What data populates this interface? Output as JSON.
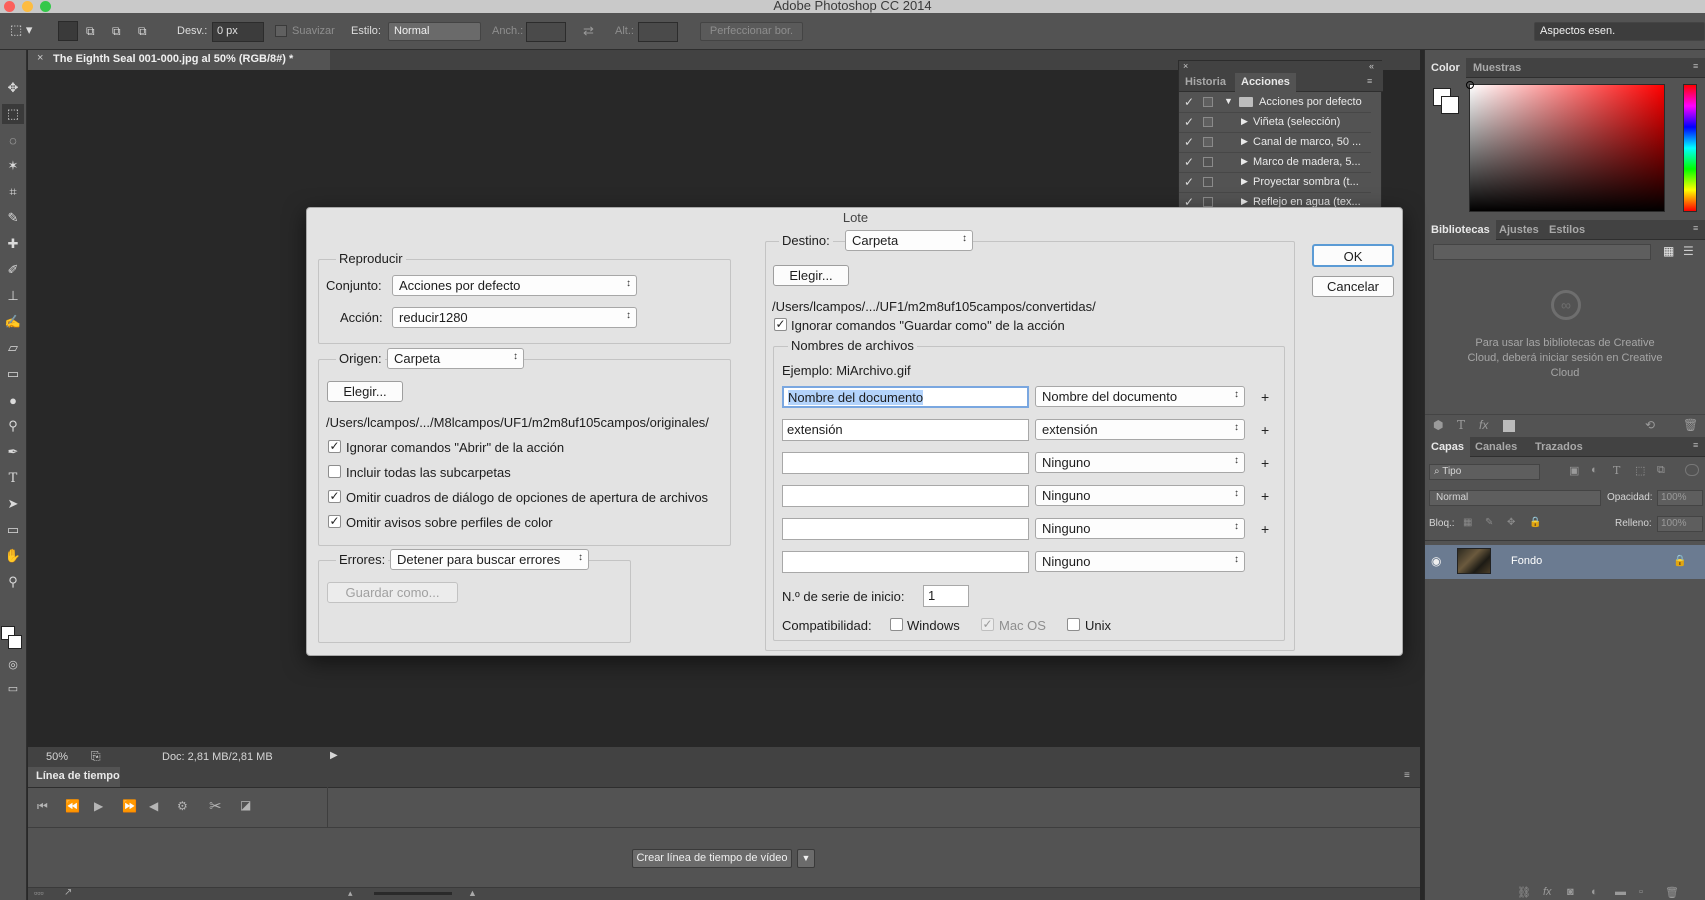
{
  "app": {
    "title": "Adobe Photoshop CC 2014"
  },
  "options_bar": {
    "desv_label": "Desv.:",
    "desv_value": "0 px",
    "suavizar_label": "Suavizar",
    "estilo_label": "Estilo:",
    "estilo_value": "Normal",
    "anch_label": "Anch.:",
    "alt_label": "Alt.:",
    "refine_label": "Perfeccionar bor.",
    "workspace": "Aspectos esen."
  },
  "document": {
    "tab_title": "The Eighth Seal 001-000.jpg al 50% (RGB/8#) *",
    "zoom": "50%",
    "doc_info": "Doc: 2,81 MB/2,81 MB"
  },
  "timeline": {
    "title": "Línea de tiempo",
    "create_button": "Crear línea de tiempo de vídeo"
  },
  "actions_panel": {
    "tabs": [
      "Historia",
      "Acciones"
    ],
    "items": [
      {
        "label": "Acciones por defecto"
      },
      {
        "label": "Viñeta (selección)"
      },
      {
        "label": "Canal de marco, 50 ..."
      },
      {
        "label": "Marco de madera, 5..."
      },
      {
        "label": "Proyectar sombra (t..."
      },
      {
        "label": "Reflejo en agua (tex..."
      }
    ]
  },
  "color_panel": {
    "tabs": [
      "Color",
      "Muestras"
    ]
  },
  "libraries_panel": {
    "tabs": [
      "Bibliotecas",
      "Ajustes",
      "Estilos"
    ],
    "message": "Para usar las bibliotecas de Creative Cloud, deberá iniciar sesión en Creative Cloud"
  },
  "layers_panel": {
    "tabs": [
      "Capas",
      "Canales",
      "Trazados"
    ],
    "filter": "Tipo",
    "blend_mode": "Normal",
    "opacity_label": "Opacidad:",
    "opacity_value": "100%",
    "lock_label": "Bloq.:",
    "fill_label": "Relleno:",
    "fill_value": "100%",
    "layers": [
      {
        "name": "Fondo"
      }
    ]
  },
  "dialog": {
    "title": "Lote",
    "ok": "OK",
    "cancel": "Cancelar",
    "reproducir": {
      "legend": "Reproducir",
      "conjunto_label": "Conjunto:",
      "conjunto_value": "Acciones por defecto",
      "accion_label": "Acción:",
      "accion_value": "reducir1280"
    },
    "origen": {
      "label": "Origen:",
      "value": "Carpeta",
      "choose": "Elegir...",
      "path": "/Users/lcampos/.../M8lcampos/UF1/m2m8uf105campos/originales/",
      "options": [
        {
          "label": "Ignorar comandos \"Abrir\" de la acción",
          "checked": true
        },
        {
          "label": "Incluir todas las subcarpetas",
          "checked": false
        },
        {
          "label": "Omitir cuadros de diálogo de opciones de apertura de archivos",
          "checked": true
        },
        {
          "label": "Omitir avisos sobre perfiles de color",
          "checked": true
        }
      ]
    },
    "errores": {
      "label": "Errores:",
      "value": "Detener para buscar errores",
      "save_as": "Guardar como..."
    },
    "destino": {
      "label": "Destino:",
      "value": "Carpeta",
      "choose": "Elegir...",
      "path": "/Users/lcampos/.../UF1/m2m8uf105campos/convertidas/",
      "ignore_save": "Ignorar comandos \"Guardar como\" de la acción",
      "ignore_save_checked": true
    },
    "nombres": {
      "legend": "Nombres de archivos",
      "example": "Ejemplo: MiArchivo.gif",
      "rows": [
        {
          "field": "Nombre del documento",
          "select": "Nombre del documento",
          "plus": "+"
        },
        {
          "field": "extensión",
          "select": "extensión",
          "plus": "+"
        },
        {
          "field": "",
          "select": "Ninguno",
          "plus": "+"
        },
        {
          "field": "",
          "select": "Ninguno",
          "plus": "+"
        },
        {
          "field": "",
          "select": "Ninguno",
          "plus": "+"
        },
        {
          "field": "",
          "select": "Ninguno",
          "plus": ""
        }
      ],
      "serial_label": "N.º de serie de inicio:",
      "serial_value": "1",
      "compat_label": "Compatibilidad:",
      "compat": [
        {
          "label": "Windows",
          "checked": false,
          "disabled": false
        },
        {
          "label": "Mac OS",
          "checked": true,
          "disabled": true
        },
        {
          "label": "Unix",
          "checked": false,
          "disabled": false
        }
      ]
    }
  }
}
